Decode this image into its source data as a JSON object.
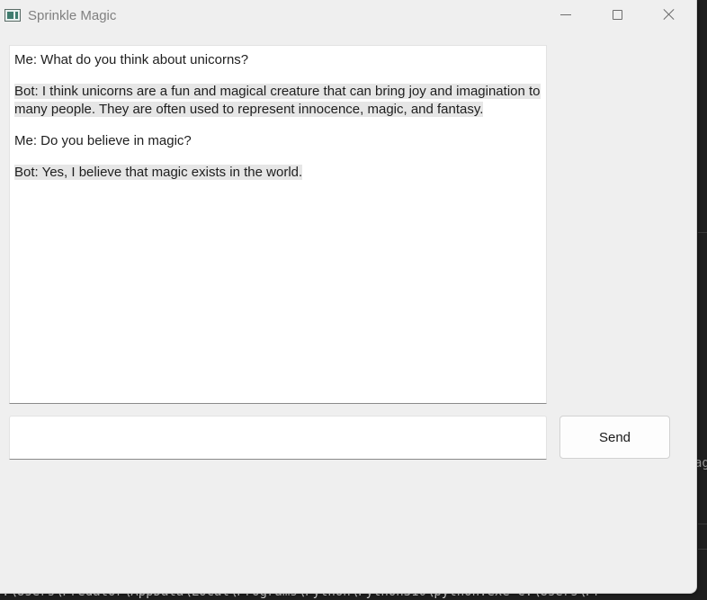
{
  "window": {
    "title": "Sprinkle Magic"
  },
  "titlebar": {
    "icons": [
      "app-icon",
      "minimize-icon",
      "maximize-icon",
      "close-icon"
    ]
  },
  "chat": {
    "messages": [
      {
        "sender": "Me",
        "text": "Me: What do you think about unicorns?"
      },
      {
        "sender": "Bot",
        "text": "Bot: I think unicorns are a fun and magical creature that can bring joy and imagination to many people. They are often used to represent innocence, magic, and fantasy."
      },
      {
        "sender": "Me",
        "text": "Me: Do you believe in magic?"
      },
      {
        "sender": "Bot",
        "text": "Bot: Yes, I believe that magic exists in the world."
      }
    ],
    "bot_highlight_color": "#e6e6e6"
  },
  "input": {
    "value": "",
    "placeholder": ""
  },
  "send_button": {
    "label": "Send"
  },
  "background_console": {
    "command_fragment": ":\\Users\\Predator\\AppData\\Local\\Programs\\Python\\Python310\\python.exe C:\\Users\\Pr",
    "side_fragment": "ag"
  }
}
